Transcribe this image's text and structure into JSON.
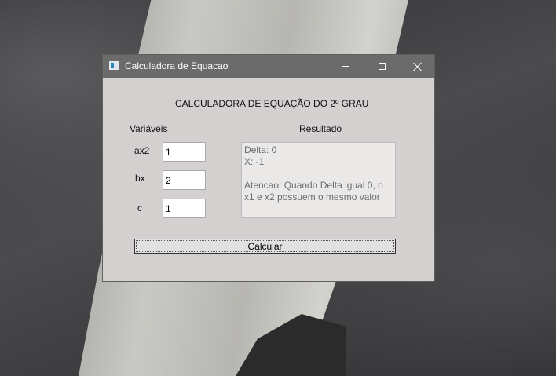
{
  "window": {
    "title": "Calculadora de Equacao",
    "heading": "CALCULADORA DE EQUAÇÃO DO 2º GRAU"
  },
  "variables": {
    "label": "Variáveis",
    "a": {
      "label": "ax2",
      "value": "1"
    },
    "b": {
      "label": "bx",
      "value": "2"
    },
    "c": {
      "label": "c",
      "value": "1"
    }
  },
  "result": {
    "label": "Resultado",
    "lines": [
      "Delta: 0",
      "X: -1",
      "",
      "Atencao: Quando Delta igual 0, o x1 e x2 possuem o mesmo valor"
    ]
  },
  "calculate_button": {
    "label": "Calcular"
  },
  "colors": {
    "titlebar": "#6b6b6b",
    "client_background": "#d4d0cf"
  }
}
